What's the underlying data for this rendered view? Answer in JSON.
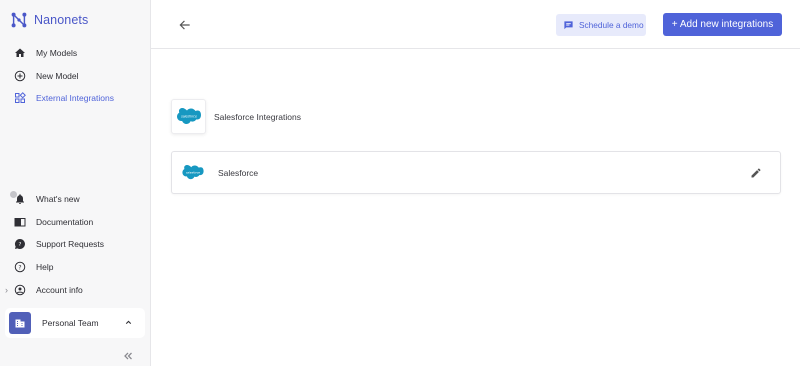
{
  "app": {
    "name": "Nanonets"
  },
  "sidebar": {
    "items": [
      {
        "label": "My Models",
        "icon": "home-icon"
      },
      {
        "label": "New Model",
        "icon": "plus-circle-icon"
      },
      {
        "label": "External Integrations",
        "icon": "grid-icon",
        "active": true
      }
    ],
    "bottom_items": [
      {
        "label": "What's new",
        "icon": "bell-icon"
      },
      {
        "label": "Documentation",
        "icon": "book-icon"
      },
      {
        "label": "Support Requests",
        "icon": "question-bubble-icon"
      },
      {
        "label": "Help",
        "icon": "help-circle-icon"
      },
      {
        "label": "Account info",
        "icon": "account-circle-icon"
      }
    ],
    "team": {
      "label": "Personal Team"
    }
  },
  "topbar": {
    "demo_label": "Schedule a demo",
    "add_label": "+ Add new integrations"
  },
  "main": {
    "section_title": "Salesforce Integrations",
    "integrations": [
      {
        "label": "Salesforce",
        "logo_text": "salesforce"
      }
    ],
    "logo_text": "salesforce"
  },
  "colors": {
    "accent": "#4f63d9",
    "brand": "#4a57c8",
    "salesforce": "#1798c1",
    "team_avatar": "#5160b8"
  }
}
